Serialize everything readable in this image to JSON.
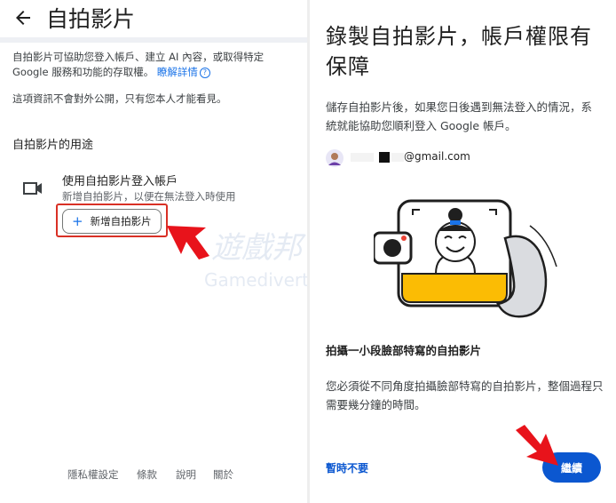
{
  "left": {
    "title": "自拍影片",
    "intro_text": "自拍影片可協助您登入帳戶、建立 AI 內容，或取得特定 Google 服務和功能的存取權。",
    "learn_more": "瞭解詳情",
    "privacy_note": "這項資訊不會對外公開，只有您本人才能看見。",
    "section_title": "自拍影片的用途",
    "item_title": "使用自拍影片登入帳戶",
    "item_subtitle": "新增自拍影片，以便在無法登入時使用",
    "add_button_label": "新增自拍影片",
    "footer_links": [
      "隱私權設定",
      "條款",
      "說明",
      "關於"
    ]
  },
  "right": {
    "title": "錄製自拍影片，帳戶權限有保障",
    "description": "儲存自拍影片後，如果您日後遇到無法登入的情況，系統就能協助您順利登入 Google 帳戶。",
    "email": "@gmail.com",
    "subsection_title": "拍攝一小段臉部特寫的自拍影片",
    "subsection_text": "您必須從不同角度拍攝臉部特寫的自拍影片，整個過程只需要幾分鐘的時間。",
    "skip_label": "暫時不要",
    "continue_label": "繼續"
  },
  "colors": {
    "accent_blue": "#0b57d0",
    "link_blue": "#1a73e8",
    "highlight_red": "#d93025",
    "annotation_arrow": "#e8131b"
  },
  "watermark": {
    "text_cn": "遊戲邦",
    "text_en": "Gamediverter"
  }
}
